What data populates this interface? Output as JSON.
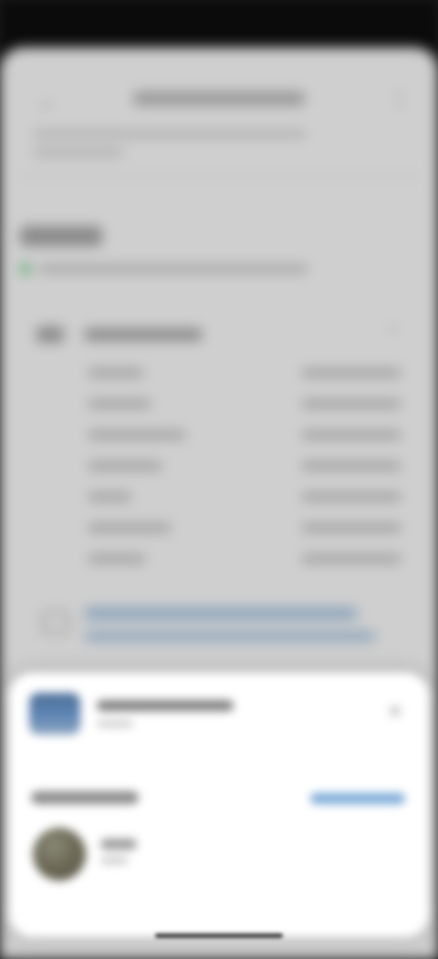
{
  "status_bar": {
    "time": "",
    "icons": ""
  },
  "background_page": {
    "title": "",
    "rows_count": 7
  },
  "bottom_sheet": {
    "item_title": "",
    "section_label": "",
    "action_label": "",
    "contact_name": ""
  }
}
